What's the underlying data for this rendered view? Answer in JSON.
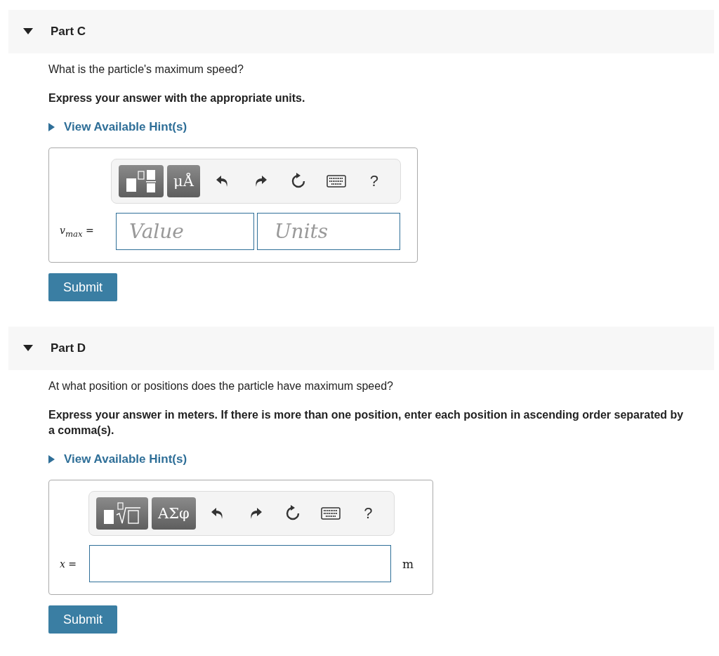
{
  "parts": [
    {
      "title": "Part C",
      "expanded": true,
      "question": "What is the particle's maximum speed?",
      "instruction": "Express your answer with the appropriate units.",
      "hint": "View Available Hint(s)",
      "answer": {
        "kind": "value_units",
        "label": "*v*$_{max}$ =",
        "tools": [
          {
            "kind": "template"
          },
          {
            "kind": "symbols",
            "text": "μÅ"
          },
          {
            "kind": "undo"
          },
          {
            "kind": "redo"
          },
          {
            "kind": "reset"
          },
          {
            "kind": "keyboard"
          },
          {
            "kind": "help",
            "text": "?"
          }
        ],
        "value_placeholder": "Value",
        "units_placeholder": "Units"
      },
      "submit": "Submit"
    },
    {
      "title": "Part D",
      "expanded": true,
      "question": "At what position or positions does the particle have maximum speed?",
      "instruction": "Express your answer in meters. If there is more than one position, enter each position in ascending order separated by a comma(s).",
      "hint": "View Available Hint(s)",
      "answer": {
        "kind": "single",
        "label": "*x* =",
        "tools": [
          {
            "kind": "template_root"
          },
          {
            "kind": "symbols",
            "text": "ΑΣφ"
          },
          {
            "kind": "undo"
          },
          {
            "kind": "redo"
          },
          {
            "kind": "reset"
          },
          {
            "kind": "keyboard"
          },
          {
            "kind": "help",
            "text": "?"
          }
        ],
        "unit": "m"
      },
      "submit": "Submit"
    }
  ]
}
